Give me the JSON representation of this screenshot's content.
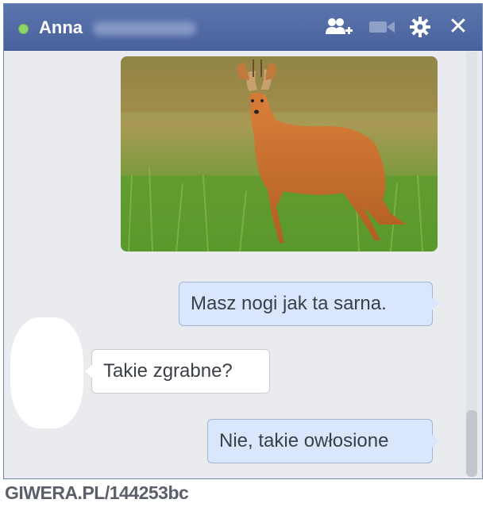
{
  "chat": {
    "contact_name": "Anna",
    "status_color": "#8fd46a",
    "header_icons": [
      "add-friend-icon",
      "video-call-icon",
      "gear-icon",
      "close-icon"
    ],
    "close_glyph": "✕"
  },
  "messages": [
    {
      "direction": "outgoing",
      "type": "image",
      "alt": "roe deer in grass"
    },
    {
      "direction": "outgoing",
      "type": "text",
      "text": "Masz nogi jak ta sarna."
    },
    {
      "direction": "incoming",
      "type": "text",
      "text": "Takie zgrabne?"
    },
    {
      "direction": "outgoing",
      "type": "text",
      "text": "Nie, takie owłosione"
    }
  ],
  "watermark": "GIWERA.PL/144253bc",
  "colors": {
    "titlebar": "#4a629c",
    "outgoing_bubble": "#dae6fb",
    "incoming_bubble": "#ffffff"
  }
}
